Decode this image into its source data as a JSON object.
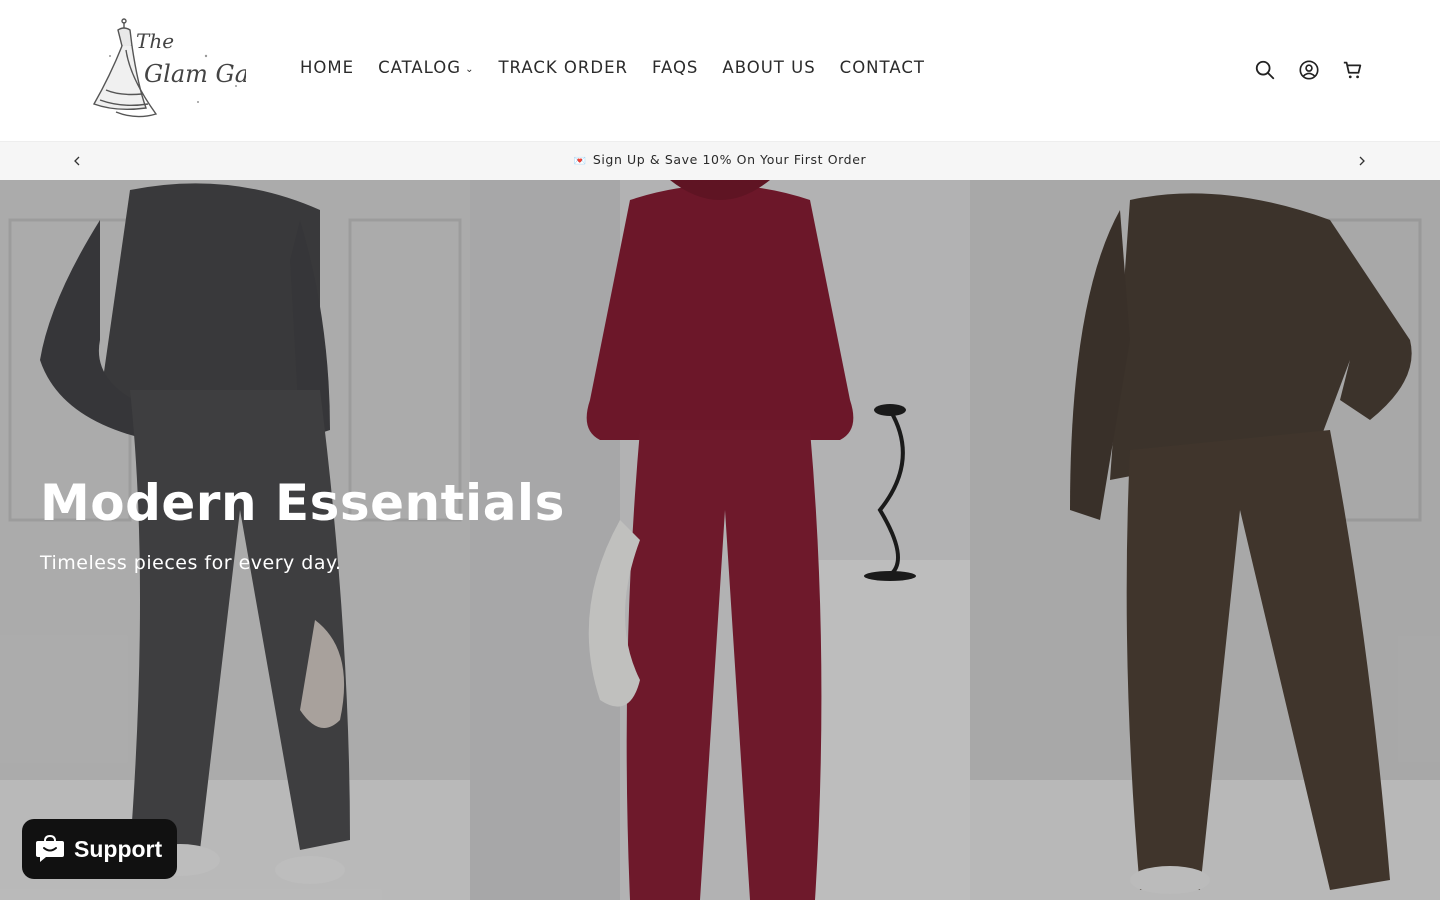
{
  "header": {
    "logo_lines": [
      "The",
      "Glam Gal"
    ],
    "nav": [
      {
        "label": "HOME"
      },
      {
        "label": "CATALOG"
      },
      {
        "label": "TRACK ORDER"
      },
      {
        "label": "FAQS"
      },
      {
        "label": "ABOUT US"
      },
      {
        "label": "CONTACT"
      }
    ],
    "icons": [
      "search-icon",
      "account-icon",
      "cart-icon"
    ]
  },
  "announcement": {
    "text": "Sign Up & Save 10% On Your First Order",
    "icon": "love-letter-icon"
  },
  "hero": {
    "title": "Modern Essentials",
    "subtitle": "Timeless pieces for every day.",
    "panels": [
      {
        "color": "#4a4a4c"
      },
      {
        "color": "#8b1e35"
      },
      {
        "color": "#4e4238"
      }
    ]
  },
  "support": {
    "label": "Support"
  }
}
